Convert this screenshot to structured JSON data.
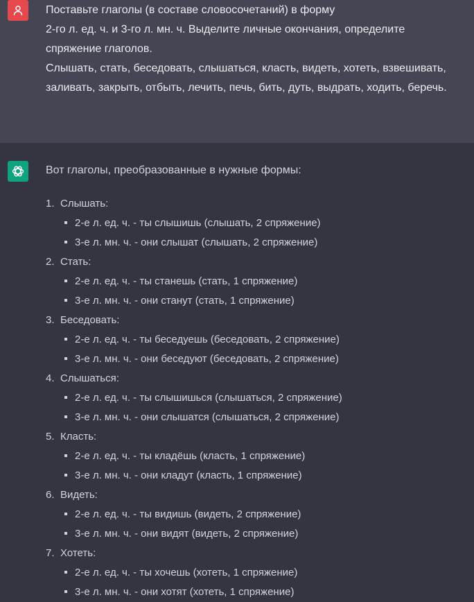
{
  "user_message": {
    "lines": [
      "Поставьте глаголы (в составе словосочетаний) в форму",
      "2-го л. ед. ч. и 3-го л. мн. ч. Выделите личные окончания, определите",
      "спряжение глаголов.",
      "Слышать, стать, беседовать, слышаться, класть, видеть, хотеть, взвешивать,",
      "заливать, закрыть, отбыть, лечить, печь, бить, дуть, выдрать, ходить, беречь."
    ]
  },
  "assistant_message": {
    "intro": "Вот глаголы, преобразованные в нужные формы:",
    "items": [
      {
        "num": "1.",
        "verb": "Слышать:",
        "forms": [
          "2-е л. ед. ч. - ты слышишь (слышать, 2 спряжение)",
          "3-е л. мн. ч. - они слышат (слышать, 2 спряжение)"
        ]
      },
      {
        "num": "2.",
        "verb": "Стать:",
        "forms": [
          "2-е л. ед. ч. - ты станешь (стать, 1 спряжение)",
          "3-е л. мн. ч. - они станут (стать, 1 спряжение)"
        ]
      },
      {
        "num": "3.",
        "verb": "Беседовать:",
        "forms": [
          "2-е л. ед. ч. - ты беседуешь (беседовать, 2 спряжение)",
          "3-е л. мн. ч. - они беседуют (беседовать, 2 спряжение)"
        ]
      },
      {
        "num": "4.",
        "verb": "Слышаться:",
        "forms": [
          "2-е л. ед. ч. - ты слышишься (слышаться, 2 спряжение)",
          "3-е л. мн. ч. - они слышатся (слышаться, 2 спряжение)"
        ]
      },
      {
        "num": "5.",
        "verb": "Класть:",
        "forms": [
          "2-е л. ед. ч. - ты кладёшь (класть, 1 спряжение)",
          "3-е л. мн. ч. - они кладут (класть, 1 спряжение)"
        ]
      },
      {
        "num": "6.",
        "verb": "Видеть:",
        "forms": [
          "2-е л. ед. ч. - ты видишь (видеть, 2 спряжение)",
          "3-е л. мн. ч. - они видят (видеть, 2 спряжение)"
        ]
      },
      {
        "num": "7.",
        "verb": "Хотеть:",
        "forms": [
          "2-е л. ед. ч. - ты хочешь (хотеть, 1 спряжение)",
          "3-е л. мн. ч. - они хотят (хотеть, 1 спряжение)"
        ]
      }
    ]
  },
  "colors": {
    "user_bg": "#444654",
    "assistant_bg": "#343541",
    "user_avatar": "#e5484d",
    "assistant_avatar": "#10a37f",
    "text": "#d1d5db"
  },
  "icons": {
    "user_avatar": "user-icon",
    "assistant_avatar": "openai-logo-icon"
  }
}
